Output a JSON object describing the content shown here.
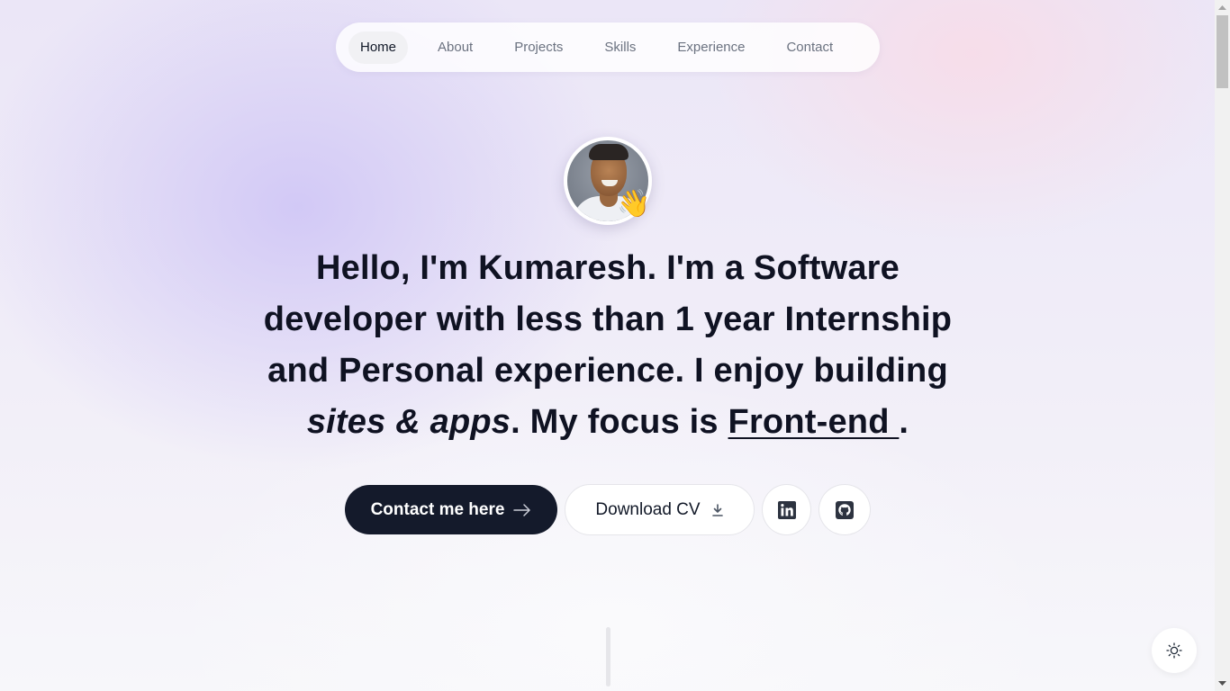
{
  "nav": {
    "items": [
      {
        "label": "Home",
        "active": true
      },
      {
        "label": "About",
        "active": false
      },
      {
        "label": "Projects",
        "active": false
      },
      {
        "label": "Skills",
        "active": false
      },
      {
        "label": "Experience",
        "active": false
      },
      {
        "label": "Contact",
        "active": false
      }
    ]
  },
  "hero": {
    "avatar_alt": "Profile photo of Kumaresh",
    "wave_emoji": "👋",
    "headline": {
      "greeting": "Hello, I'm Kumaresh.",
      "t1": " I'm a ",
      "role": "Software developer",
      "t2": " with ",
      "duration": "less than 1 year",
      "t3": " Internship and Personal experience. I enjoy building ",
      "build": "sites & apps",
      "t4": ". My focus is ",
      "focus": "Front-end ",
      "t5": "."
    },
    "buttons": {
      "contact_label": "Contact me here",
      "contact_icon": "arrow-right-icon",
      "cv_label": "Download CV",
      "cv_icon": "download-icon",
      "linkedin_icon": "linkedin-icon",
      "github_icon": "github-icon"
    }
  },
  "theme_toggle": {
    "icon": "sun-icon"
  },
  "colors": {
    "primary_button": "#141a2b",
    "text": "#0f1222",
    "nav_text": "#6b7280"
  }
}
